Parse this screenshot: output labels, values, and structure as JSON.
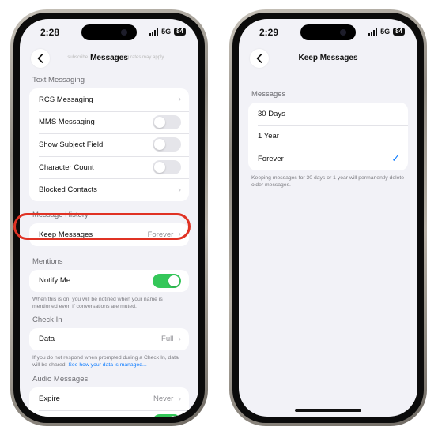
{
  "left_phone": {
    "status": {
      "time": "2:28",
      "network": "5G",
      "battery": "84"
    },
    "faded_text": "subscribe. Carrier messaging rates may apply.",
    "nav_title": "Messages",
    "text_messaging": {
      "header": "Text Messaging",
      "rows": [
        {
          "label": "RCS Messaging",
          "type": "chevron"
        },
        {
          "label": "MMS Messaging",
          "type": "toggle",
          "on": false
        },
        {
          "label": "Show Subject Field",
          "type": "toggle",
          "on": false
        },
        {
          "label": "Character Count",
          "type": "toggle",
          "on": false
        },
        {
          "label": "Blocked Contacts",
          "type": "chevron"
        }
      ]
    },
    "message_history": {
      "header": "Message History",
      "keep_label": "Keep Messages",
      "keep_value": "Forever"
    },
    "mentions": {
      "header": "Mentions",
      "notify_label": "Notify Me",
      "notify_on": true,
      "footnote": "When this is on, you will be notified when your name is mentioned even if conversations are muted."
    },
    "check_in": {
      "header": "Check In",
      "data_label": "Data",
      "data_value": "Full",
      "footnote": "If you do not respond when prompted during a Check In, data will be shared.",
      "footnote_link": "See how your data is managed..."
    },
    "audio_messages": {
      "header": "Audio Messages",
      "expire_label": "Expire",
      "expire_value": "Never"
    }
  },
  "right_phone": {
    "status": {
      "time": "2:29",
      "network": "5G",
      "battery": "84"
    },
    "nav_title": "Keep Messages",
    "section_header": "Messages",
    "options": [
      {
        "label": "30 Days",
        "selected": false
      },
      {
        "label": "1 Year",
        "selected": false
      },
      {
        "label": "Forever",
        "selected": true
      }
    ],
    "checkmark": "✓",
    "footnote": "Keeping messages for 30 days or 1 year will permanently delete older messages."
  },
  "icons": {
    "back": "chevron-left-icon",
    "disclosure": "chevron-right-icon",
    "selected": "checkmark-icon"
  },
  "colors": {
    "toggle_on": "#34c759",
    "link": "#0a7aff",
    "highlight": "#e03224",
    "background": "#f2f2f7"
  }
}
